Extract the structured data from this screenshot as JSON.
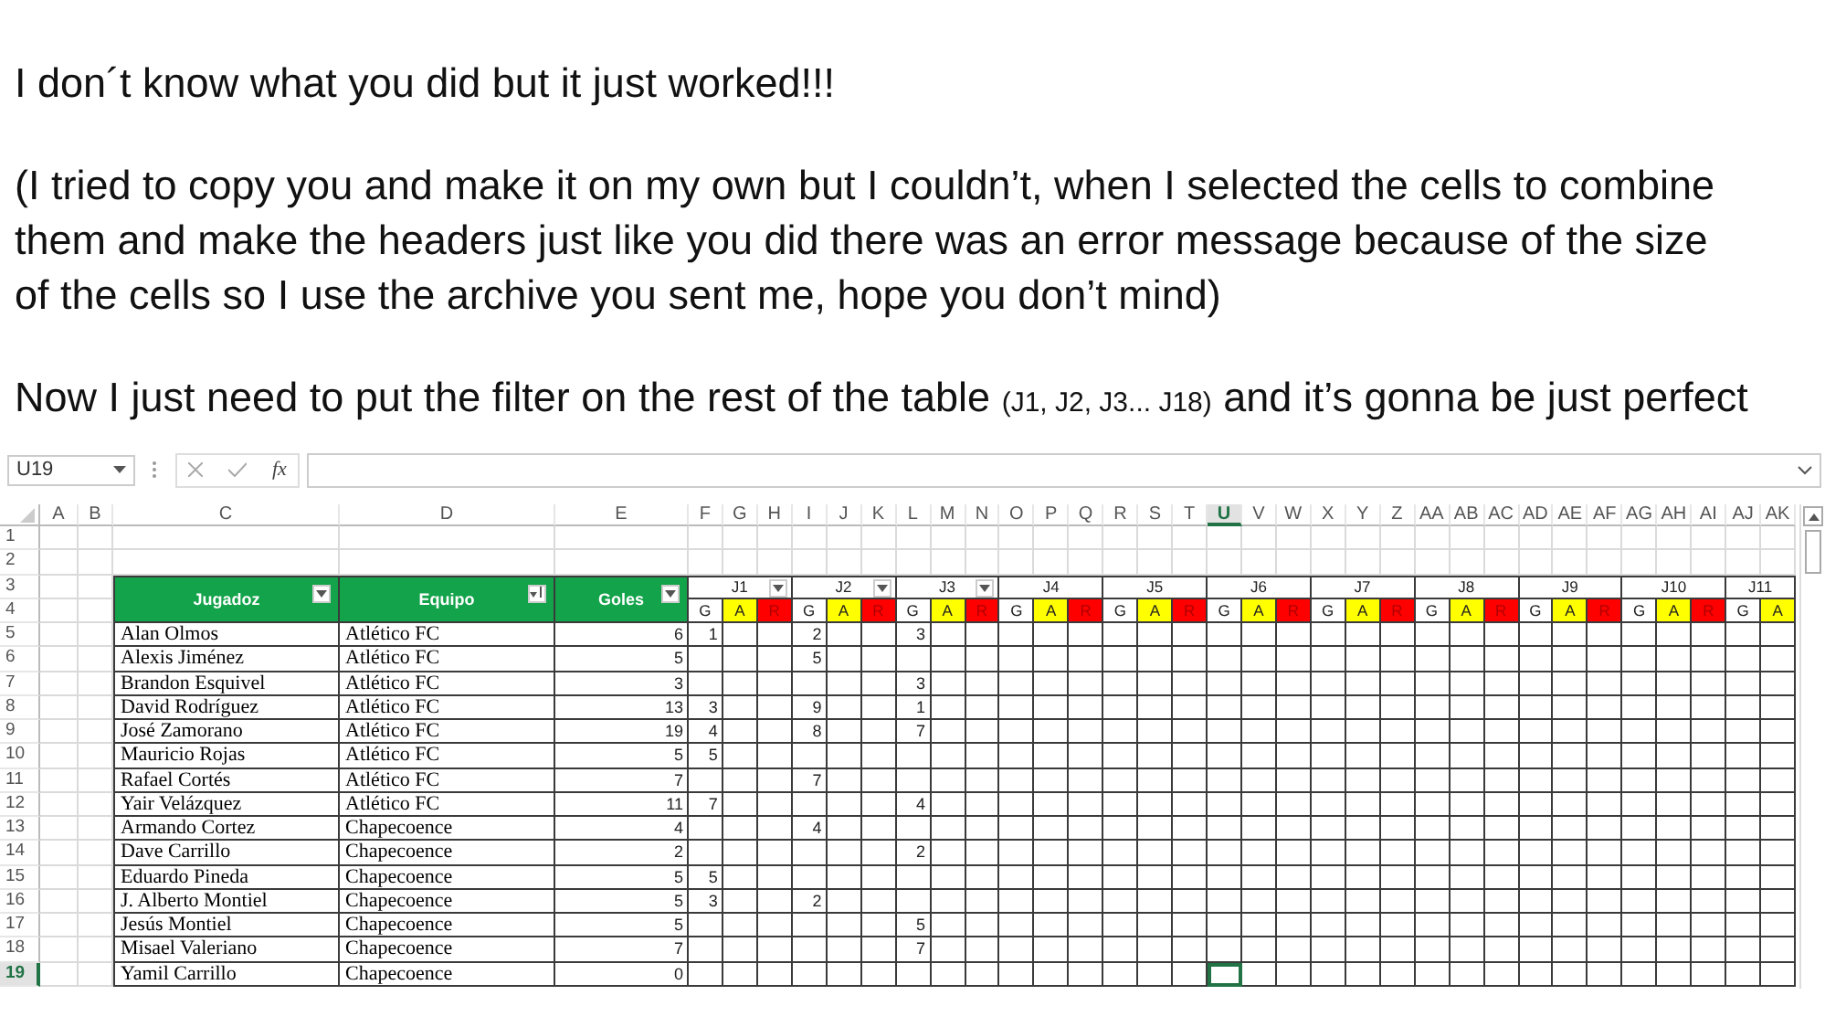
{
  "message": [
    {
      "kind": "plain",
      "lines": [
        "I don´t know what you did but it just worked!!!"
      ]
    },
    {
      "kind": "plain",
      "lines": [
        "(I tried to copy you and make it on my own but I couldn’t, when I selected the cells to combine",
        "them and make the headers just like you did there was an error message because of the size",
        "of the cells so I use the archive you sent me, hope you don’t mind)"
      ]
    },
    {
      "kind": "noted",
      "text": "Now I just need to put the filter on the rest of the table",
      "note": "(J1, J2, J3... J18)",
      "tail": "and it’s gonna be just perfect"
    }
  ],
  "formula_bar": {
    "name_box": "U19",
    "fx": "fx"
  },
  "sheet": {
    "columns": [
      {
        "label": "A",
        "selected": false
      },
      {
        "label": "B",
        "selected": false
      },
      {
        "label": "C",
        "selected": false
      },
      {
        "label": "D",
        "selected": false
      },
      {
        "label": "E",
        "selected": false
      },
      {
        "label": "F",
        "selected": false
      },
      {
        "label": "G",
        "selected": false
      },
      {
        "label": "H",
        "selected": false
      },
      {
        "label": "I",
        "selected": false
      },
      {
        "label": "J",
        "selected": false
      },
      {
        "label": "K",
        "selected": false
      },
      {
        "label": "L",
        "selected": false
      },
      {
        "label": "M",
        "selected": false
      },
      {
        "label": "N",
        "selected": false
      },
      {
        "label": "O",
        "selected": false
      },
      {
        "label": "P",
        "selected": false
      },
      {
        "label": "Q",
        "selected": false
      },
      {
        "label": "R",
        "selected": false
      },
      {
        "label": "S",
        "selected": false
      },
      {
        "label": "T",
        "selected": false
      },
      {
        "label": "U",
        "selected": true
      },
      {
        "label": "V",
        "selected": false
      },
      {
        "label": "W",
        "selected": false
      },
      {
        "label": "X",
        "selected": false
      },
      {
        "label": "Y",
        "selected": false
      },
      {
        "label": "Z",
        "selected": false
      },
      {
        "label": "AA",
        "selected": false
      },
      {
        "label": "AB",
        "selected": false
      },
      {
        "label": "AC",
        "selected": false
      },
      {
        "label": "AD",
        "selected": false
      },
      {
        "label": "AE",
        "selected": false
      },
      {
        "label": "AF",
        "selected": false
      },
      {
        "label": "AG",
        "selected": false
      },
      {
        "label": "AH",
        "selected": false
      },
      {
        "label": "AI",
        "selected": false
      },
      {
        "label": "AJ",
        "selected": false
      },
      {
        "label": "AK",
        "selected": false
      }
    ],
    "rows": [
      {
        "label": "1",
        "selected": false
      },
      {
        "label": "2",
        "selected": false
      },
      {
        "label": "3",
        "selected": false
      },
      {
        "label": "4",
        "selected": false
      },
      {
        "label": "5",
        "selected": false
      },
      {
        "label": "6",
        "selected": false
      },
      {
        "label": "7",
        "selected": false
      },
      {
        "label": "8",
        "selected": false
      },
      {
        "label": "9",
        "selected": false
      },
      {
        "label": "10",
        "selected": false
      },
      {
        "label": "11",
        "selected": false
      },
      {
        "label": "12",
        "selected": false
      },
      {
        "label": "13",
        "selected": false
      },
      {
        "label": "14",
        "selected": false
      },
      {
        "label": "15",
        "selected": false
      },
      {
        "label": "16",
        "selected": false
      },
      {
        "label": "17",
        "selected": false
      },
      {
        "label": "18",
        "selected": false
      },
      {
        "label": "19",
        "selected": true
      }
    ],
    "headers": [
      {
        "label": "Jugadoz",
        "sorted": false
      },
      {
        "label": "Equipo",
        "sorted": true
      },
      {
        "label": "Goles",
        "sorted": false
      }
    ],
    "rounds": [
      {
        "label": "J1",
        "filter": true,
        "subs": [
          {
            "label": "G",
            "kind": "goals"
          },
          {
            "label": "A",
            "kind": "assists"
          },
          {
            "label": "R",
            "kind": "reds"
          }
        ]
      },
      {
        "label": "J2",
        "filter": true,
        "subs": [
          {
            "label": "G",
            "kind": "goals"
          },
          {
            "label": "A",
            "kind": "assists"
          },
          {
            "label": "R",
            "kind": "reds"
          }
        ]
      },
      {
        "label": "J3",
        "filter": true,
        "subs": [
          {
            "label": "G",
            "kind": "goals"
          },
          {
            "label": "A",
            "kind": "assists"
          },
          {
            "label": "R",
            "kind": "reds"
          }
        ]
      },
      {
        "label": "J4",
        "filter": false,
        "subs": [
          {
            "label": "G",
            "kind": "goals"
          },
          {
            "label": "A",
            "kind": "assists"
          },
          {
            "label": "R",
            "kind": "reds"
          }
        ]
      },
      {
        "label": "J5",
        "filter": false,
        "subs": [
          {
            "label": "G",
            "kind": "goals"
          },
          {
            "label": "A",
            "kind": "assists"
          },
          {
            "label": "R",
            "kind": "reds"
          }
        ]
      },
      {
        "label": "J6",
        "filter": false,
        "subs": [
          {
            "label": "G",
            "kind": "goals"
          },
          {
            "label": "A",
            "kind": "assists"
          },
          {
            "label": "R",
            "kind": "reds"
          }
        ]
      },
      {
        "label": "J7",
        "filter": false,
        "subs": [
          {
            "label": "G",
            "kind": "goals"
          },
          {
            "label": "A",
            "kind": "assists"
          },
          {
            "label": "R",
            "kind": "reds"
          }
        ]
      },
      {
        "label": "J8",
        "filter": false,
        "subs": [
          {
            "label": "G",
            "kind": "goals"
          },
          {
            "label": "A",
            "kind": "assists"
          },
          {
            "label": "R",
            "kind": "reds"
          }
        ]
      },
      {
        "label": "J9",
        "filter": false,
        "subs": [
          {
            "label": "G",
            "kind": "goals"
          },
          {
            "label": "A",
            "kind": "assists"
          },
          {
            "label": "R",
            "kind": "reds"
          }
        ]
      },
      {
        "label": "J10",
        "filter": false,
        "subs": [
          {
            "label": "G",
            "kind": "goals"
          },
          {
            "label": "A",
            "kind": "assists"
          },
          {
            "label": "R",
            "kind": "reds"
          }
        ]
      },
      {
        "label": "J11",
        "filter": false,
        "subs": [
          {
            "label": "G",
            "kind": "goals"
          },
          {
            "label": "A",
            "kind": "assists"
          }
        ]
      }
    ],
    "players": [
      {
        "name": "Alan Olmos",
        "team": "Atlético FC",
        "goals": "6",
        "j1": "1",
        "j2": "2",
        "j3": "3"
      },
      {
        "name": "Alexis Jiménez",
        "team": "Atlético FC",
        "goals": "5",
        "j2": "5"
      },
      {
        "name": "Brandon Esquivel",
        "team": "Atlético FC",
        "goals": "3",
        "j3": "3"
      },
      {
        "name": "David Rodríguez",
        "team": "Atlético FC",
        "goals": "13",
        "j1": "3",
        "j2": "9",
        "j3": "1"
      },
      {
        "name": "José Zamorano",
        "team": "Atlético FC",
        "goals": "19",
        "j1": "4",
        "j2": "8",
        "j3": "7"
      },
      {
        "name": "Mauricio Rojas",
        "team": "Atlético FC",
        "goals": "5",
        "j1": "5"
      },
      {
        "name": "Rafael Cortés",
        "team": "Atlético FC",
        "goals": "7",
        "j2": "7"
      },
      {
        "name": "Yair Velázquez",
        "team": "Atlético FC",
        "goals": "11",
        "j1": "7",
        "j3": "4"
      },
      {
        "name": "Armando Cortez",
        "team": "Chapecoence",
        "goals": "4",
        "j2": "4"
      },
      {
        "name": "Dave Carrillo",
        "team": "Chapecoence",
        "goals": "2",
        "j3": "2"
      },
      {
        "name": "Eduardo Pineda",
        "team": "Chapecoence",
        "goals": "5",
        "j1": "5"
      },
      {
        "name": "J. Alberto Montiel",
        "team": "Chapecoence",
        "goals": "5",
        "j1": "3",
        "j2": "2"
      },
      {
        "name": "Jesús Montiel",
        "team": "Chapecoence",
        "goals": "5",
        "j3": "5"
      },
      {
        "name": "Misael Valeriano",
        "team": "Chapecoence",
        "goals": "7",
        "j3": "7"
      },
      {
        "name": "Yamil Carrillo",
        "team": "Chapecoence",
        "goals": "0"
      }
    ]
  }
}
